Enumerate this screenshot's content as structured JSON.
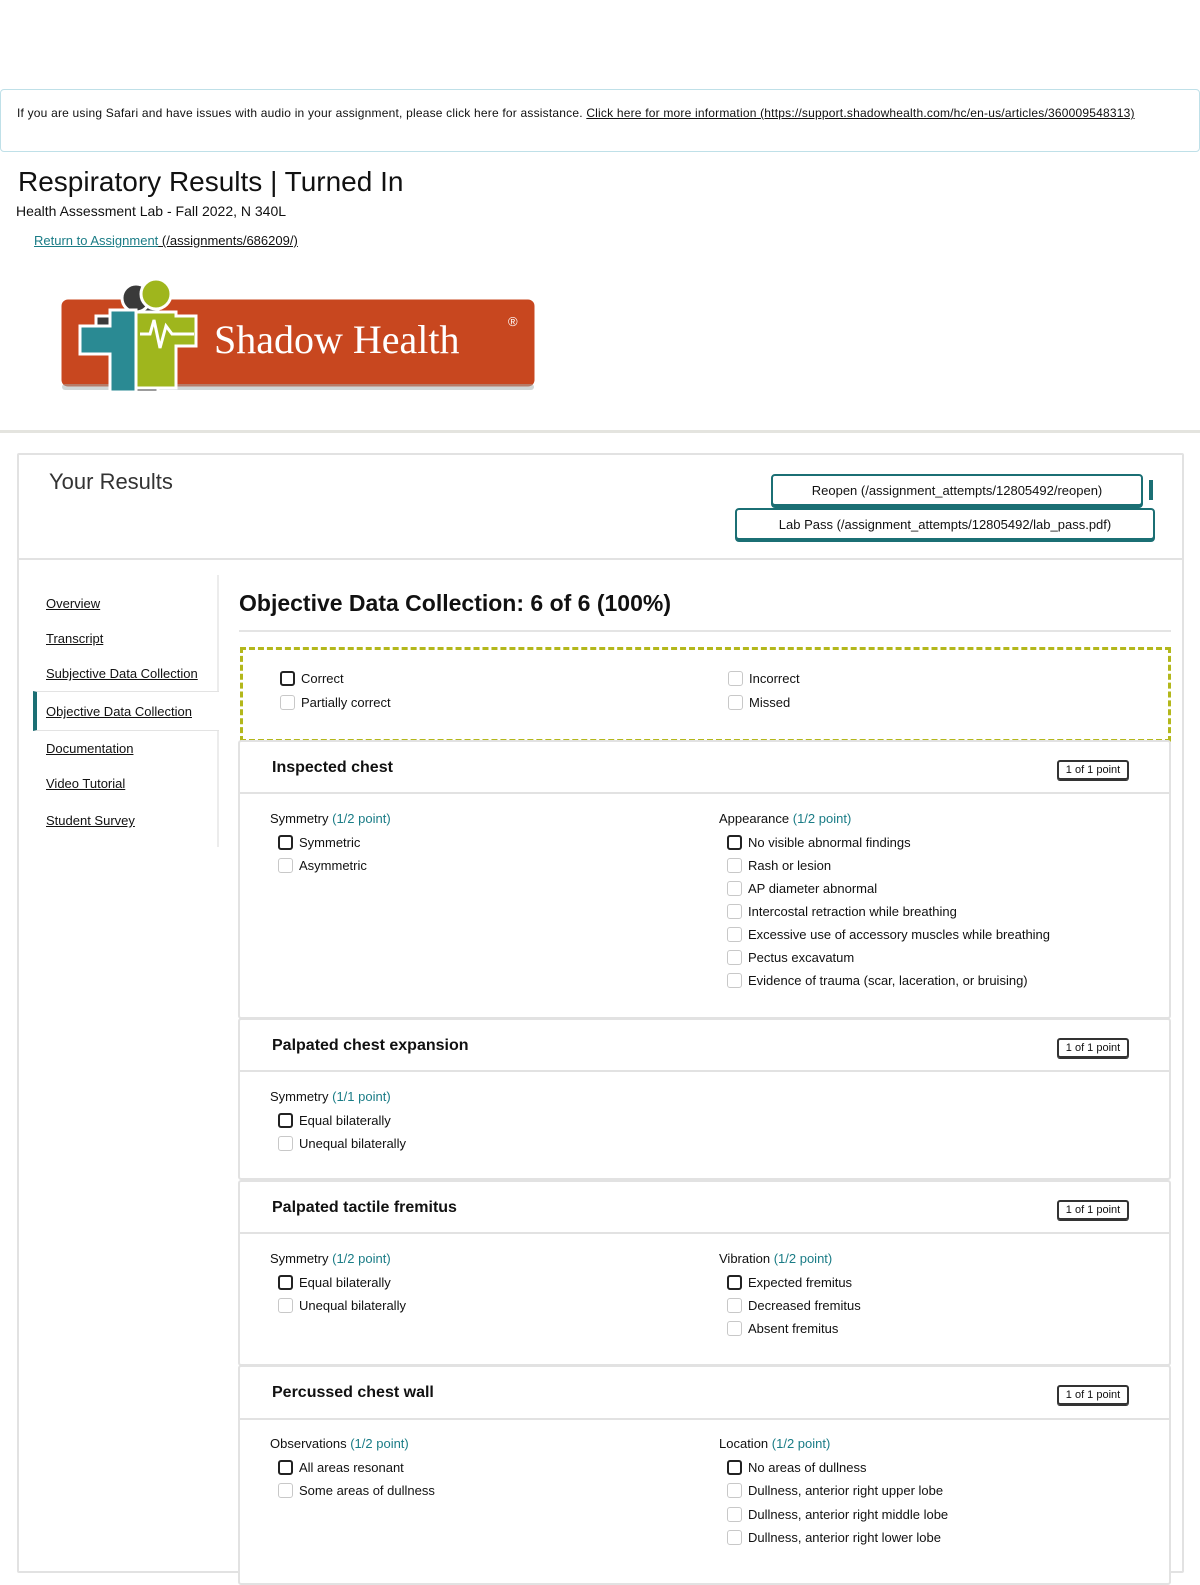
{
  "notice": {
    "text": "If you are using Safari and have issues with audio in your assignment, please click here for assistance.",
    "link_text": "Click here for more information (https://support.shadowhealth.com/hc/en-us/articles/360009548313)"
  },
  "page": {
    "title": "Respiratory Results | Turned In",
    "course": "Health Assessment Lab - Fall 2022, N 340L",
    "return_link_text": "Return to Assignment",
    "return_link_url": "(/assignments/686209/)",
    "logo_text": "Shadow Health",
    "logo_registered": "®"
  },
  "results": {
    "title": "Your Results",
    "reopen_label": "Reopen (/assignment_attempts/12805492/reopen)",
    "lab_pass_label": "Lab Pass (/assignment_attempts/12805492/lab_pass.pdf)"
  },
  "sidebar": {
    "items": [
      {
        "label": "Overview"
      },
      {
        "label": "Transcript"
      },
      {
        "label": "Subjective Data Collection"
      },
      {
        "label": "Objective Data Collection",
        "active": true
      },
      {
        "label": "Documentation"
      },
      {
        "label": "Video Tutorial"
      },
      {
        "label": "Student Survey"
      }
    ]
  },
  "section": {
    "title": "Objective Data Collection: 6 of 6 (100%)"
  },
  "legend": {
    "correct": "Correct",
    "partially_correct": "Partially correct",
    "incorrect": "Incorrect",
    "missed": "Missed"
  },
  "items": [
    {
      "title": "Inspected chest",
      "score": "1 of 1 point",
      "groups": [
        {
          "label": "Symmetry",
          "points": "(1/2 point)",
          "options": [
            {
              "label": "Symmetric",
              "checked": true
            },
            {
              "label": "Asymmetric",
              "checked": false
            }
          ]
        },
        {
          "label": "Appearance",
          "points": "(1/2 point)",
          "options": [
            {
              "label": "No visible abnormal findings",
              "checked": true
            },
            {
              "label": "Rash or lesion",
              "checked": false
            },
            {
              "label": "AP diameter abnormal",
              "checked": false
            },
            {
              "label": "Intercostal retraction while breathing",
              "checked": false
            },
            {
              "label": "Excessive use of accessory muscles while breathing",
              "checked": false
            },
            {
              "label": "Pectus excavatum",
              "checked": false
            },
            {
              "label": "Evidence of trauma (scar, laceration, or bruising)",
              "checked": false
            }
          ]
        }
      ]
    },
    {
      "title": "Palpated chest expansion",
      "score": "1 of 1 point",
      "groups": [
        {
          "label": "Symmetry",
          "points": "(1/1 point)",
          "options": [
            {
              "label": "Equal bilaterally",
              "checked": true
            },
            {
              "label": "Unequal bilaterally",
              "checked": false
            }
          ]
        }
      ]
    },
    {
      "title": "Palpated tactile fremitus",
      "score": "1 of 1 point",
      "groups": [
        {
          "label": "Symmetry",
          "points": "(1/2 point)",
          "options": [
            {
              "label": "Equal bilaterally",
              "checked": true
            },
            {
              "label": "Unequal bilaterally",
              "checked": false
            }
          ]
        },
        {
          "label": "Vibration",
          "points": "(1/2 point)",
          "options": [
            {
              "label": "Expected fremitus",
              "checked": true
            },
            {
              "label": "Decreased fremitus",
              "checked": false
            },
            {
              "label": "Absent fremitus",
              "checked": false
            }
          ]
        }
      ]
    },
    {
      "title": "Percussed chest wall",
      "score": "1 of 1 point",
      "groups": [
        {
          "label": "Observations",
          "points": "(1/2 point)",
          "options": [
            {
              "label": "All areas resonant",
              "checked": true
            },
            {
              "label": "Some areas of dullness",
              "checked": false
            }
          ]
        },
        {
          "label": "Location",
          "points": "(1/2 point)",
          "options": [
            {
              "label": "No areas of dullness",
              "checked": true
            },
            {
              "label": "Dullness, anterior right upper lobe",
              "checked": false
            },
            {
              "label": "Dullness, anterior right middle lobe",
              "checked": false
            },
            {
              "label": "Dullness, anterior right lower lobe",
              "checked": false
            }
          ]
        }
      ]
    }
  ],
  "colors": {
    "accent": "#1b6f74",
    "link": "#1a7c86",
    "legend_border": "#b3b71b",
    "logo_bg": "#c8471f",
    "logo_figure": "#9fb61d"
  }
}
